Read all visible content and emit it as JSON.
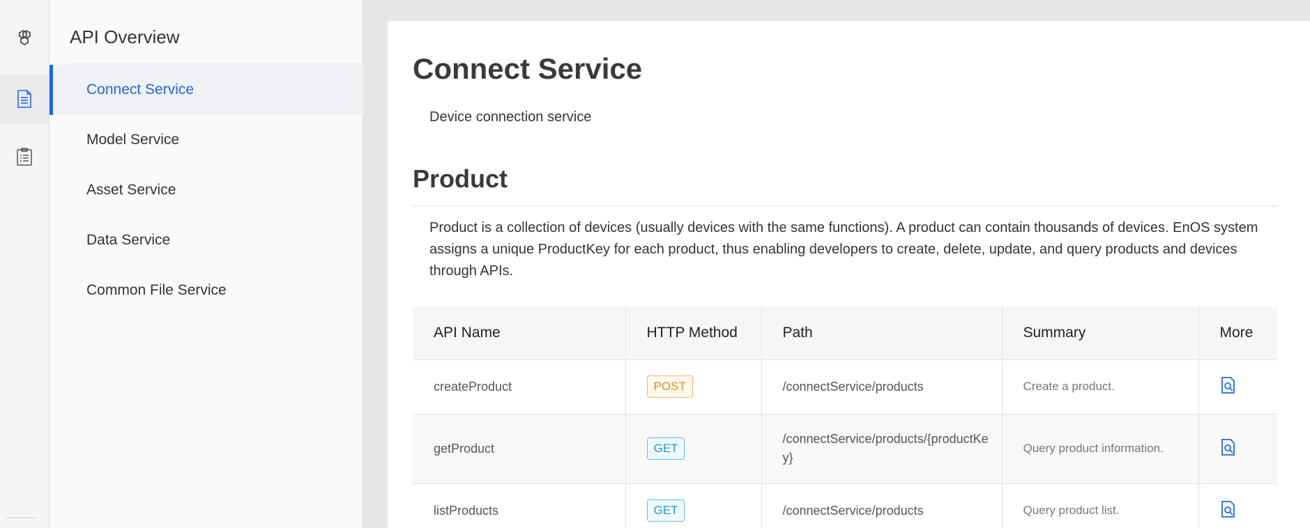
{
  "rail": {
    "icons": [
      "cubes-icon",
      "document-icon",
      "clipboard-list-icon"
    ]
  },
  "sidenav": {
    "title": "API Overview",
    "items": [
      {
        "label": "Connect Service",
        "active": true
      },
      {
        "label": "Model Service",
        "active": false
      },
      {
        "label": "Asset Service",
        "active": false
      },
      {
        "label": "Data Service",
        "active": false
      },
      {
        "label": "Common File Service",
        "active": false
      }
    ]
  },
  "content": {
    "title": "Connect Service",
    "description": "Device connection service",
    "section": {
      "title": "Product",
      "description": "Product is a collection of devices (usually devices with the same functions). A product can contain thousands of devices. EnOS system assigns a unique ProductKey for each product, thus enabling developers to create, delete, update, and query products and devices through APIs."
    },
    "table": {
      "headers": [
        "API Name",
        "HTTP Method",
        "Path",
        "Summary",
        "More"
      ],
      "rows": [
        {
          "name": "createProduct",
          "method": "POST",
          "path": "/connectService/products",
          "summary": "Create a product."
        },
        {
          "name": "getProduct",
          "method": "GET",
          "path": "/connectService/products/{productKey}",
          "summary": "Query product information."
        },
        {
          "name": "listProducts",
          "method": "GET",
          "path": "/connectService/products",
          "summary": "Query product list."
        }
      ]
    }
  },
  "colors": {
    "accent": "#1f68e0",
    "post": "#f08c1a",
    "get": "#1d9cd8"
  }
}
